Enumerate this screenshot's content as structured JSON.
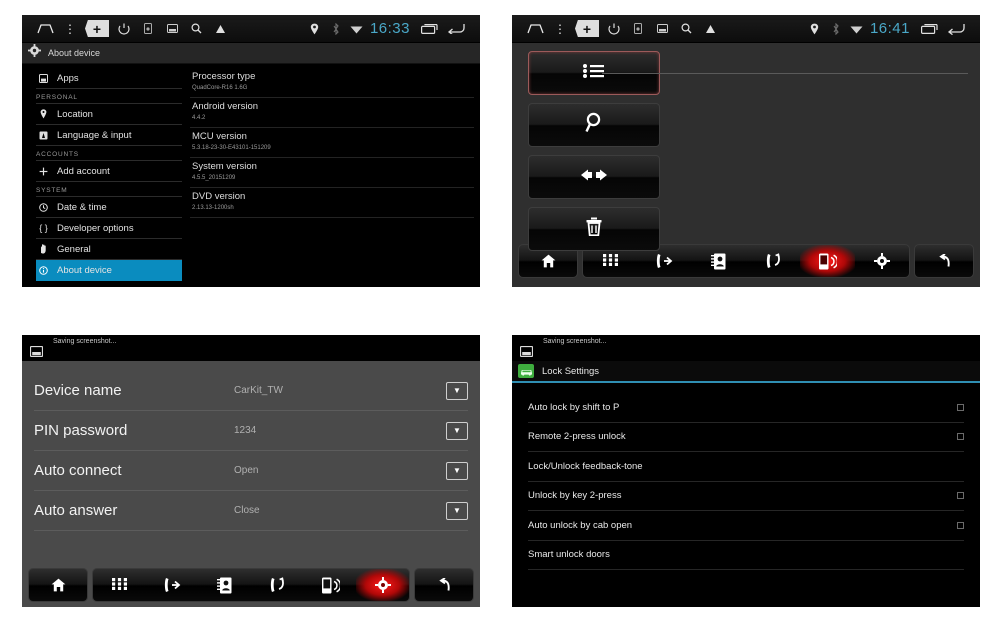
{
  "statusbar": {
    "clock_panel1": "16:33",
    "clock_panel2": "16:41",
    "icons": [
      "home-icon",
      "menu-dots-icon",
      "plus-key-icon",
      "power-icon",
      "sd-card-icon",
      "screenshot-icon",
      "search-icon",
      "warning-icon",
      "location-icon",
      "bluetooth-icon",
      "wifi-icon"
    ],
    "plus_glyph": "+",
    "recents_icon": "recents-icon",
    "back_icon": "back-icon"
  },
  "panel1": {
    "title": "About device",
    "title_icon": "gear-icon",
    "menu": [
      {
        "label": "Apps",
        "icon": "apps-icon",
        "type": "item",
        "selected": false
      },
      {
        "label": "PERSONAL",
        "type": "header"
      },
      {
        "label": "Location",
        "icon": "location-icon",
        "type": "item",
        "selected": false
      },
      {
        "label": "Language & input",
        "icon": "language-icon",
        "type": "item",
        "selected": false
      },
      {
        "label": "ACCOUNTS",
        "type": "header"
      },
      {
        "label": "Add account",
        "icon": "plus-icon",
        "type": "item",
        "selected": false
      },
      {
        "label": "SYSTEM",
        "type": "header"
      },
      {
        "label": "Date & time",
        "icon": "clock-icon",
        "type": "item",
        "selected": false
      },
      {
        "label": "Developer options",
        "icon": "braces-icon",
        "type": "item",
        "selected": false
      },
      {
        "label": "General",
        "icon": "hand-icon",
        "type": "item",
        "selected": false
      },
      {
        "label": "About device",
        "icon": "info-icon",
        "type": "item",
        "selected": true
      }
    ],
    "info": [
      {
        "key": "Processor type",
        "value": "QuadCore-R16 1.6G"
      },
      {
        "key": "Android version",
        "value": "4.4.2"
      },
      {
        "key": "MCU version",
        "value": "5.3.18-23-30-E43101-151209"
      },
      {
        "key": "System version",
        "value": "4.5.5_20151209"
      },
      {
        "key": "DVD version",
        "value": "2.13.13-1200sh"
      }
    ]
  },
  "panel2": {
    "buttons": [
      {
        "name": "list-button",
        "icon": "list-icon",
        "active": true
      },
      {
        "name": "search-button",
        "icon": "search-icon",
        "active": false
      },
      {
        "name": "sync-button",
        "icon": "transfer-icon",
        "active": false
      },
      {
        "name": "delete-button",
        "icon": "trash-icon",
        "active": false
      }
    ]
  },
  "panel3": {
    "toast": "Saving screenshot...",
    "toast_icon": "screenshot-icon",
    "rows": [
      {
        "label": "Device name",
        "value": "CarKit_TW"
      },
      {
        "label": "PIN password",
        "value": "1234"
      },
      {
        "label": "Auto connect",
        "value": "Open"
      },
      {
        "label": "Auto answer",
        "value": "Close"
      }
    ],
    "dropdown_glyph": "▼"
  },
  "panel4": {
    "toast": "Saving screenshot...",
    "toast_icon": "screenshot-icon",
    "title": "Lock Settings",
    "title_icon": "car-icon",
    "accent": "#2f8fb3",
    "rows": [
      {
        "label": "Auto lock by shift to P",
        "checkbox": true
      },
      {
        "label": "Remote 2-press unlock",
        "checkbox": true
      },
      {
        "label": "Lock/Unlock feedback-tone",
        "checkbox": false
      },
      {
        "label": "Unlock by key 2-press",
        "checkbox": true
      },
      {
        "label": "Auto unlock by cab open",
        "checkbox": true
      },
      {
        "label": "Smart unlock doors",
        "checkbox": false
      }
    ]
  },
  "navbar": {
    "home_label": "home-icon",
    "back_label": "back-icon",
    "items": [
      {
        "name": "dialpad-icon",
        "hot": false
      },
      {
        "name": "call-in-icon",
        "hot": false
      },
      {
        "name": "contacts-icon",
        "hot": false
      },
      {
        "name": "call-out-icon",
        "hot": false
      },
      {
        "name": "device-icon",
        "hot": true
      },
      {
        "name": "settings-icon",
        "hot": false
      }
    ],
    "items_p3_hot_index": 5
  }
}
